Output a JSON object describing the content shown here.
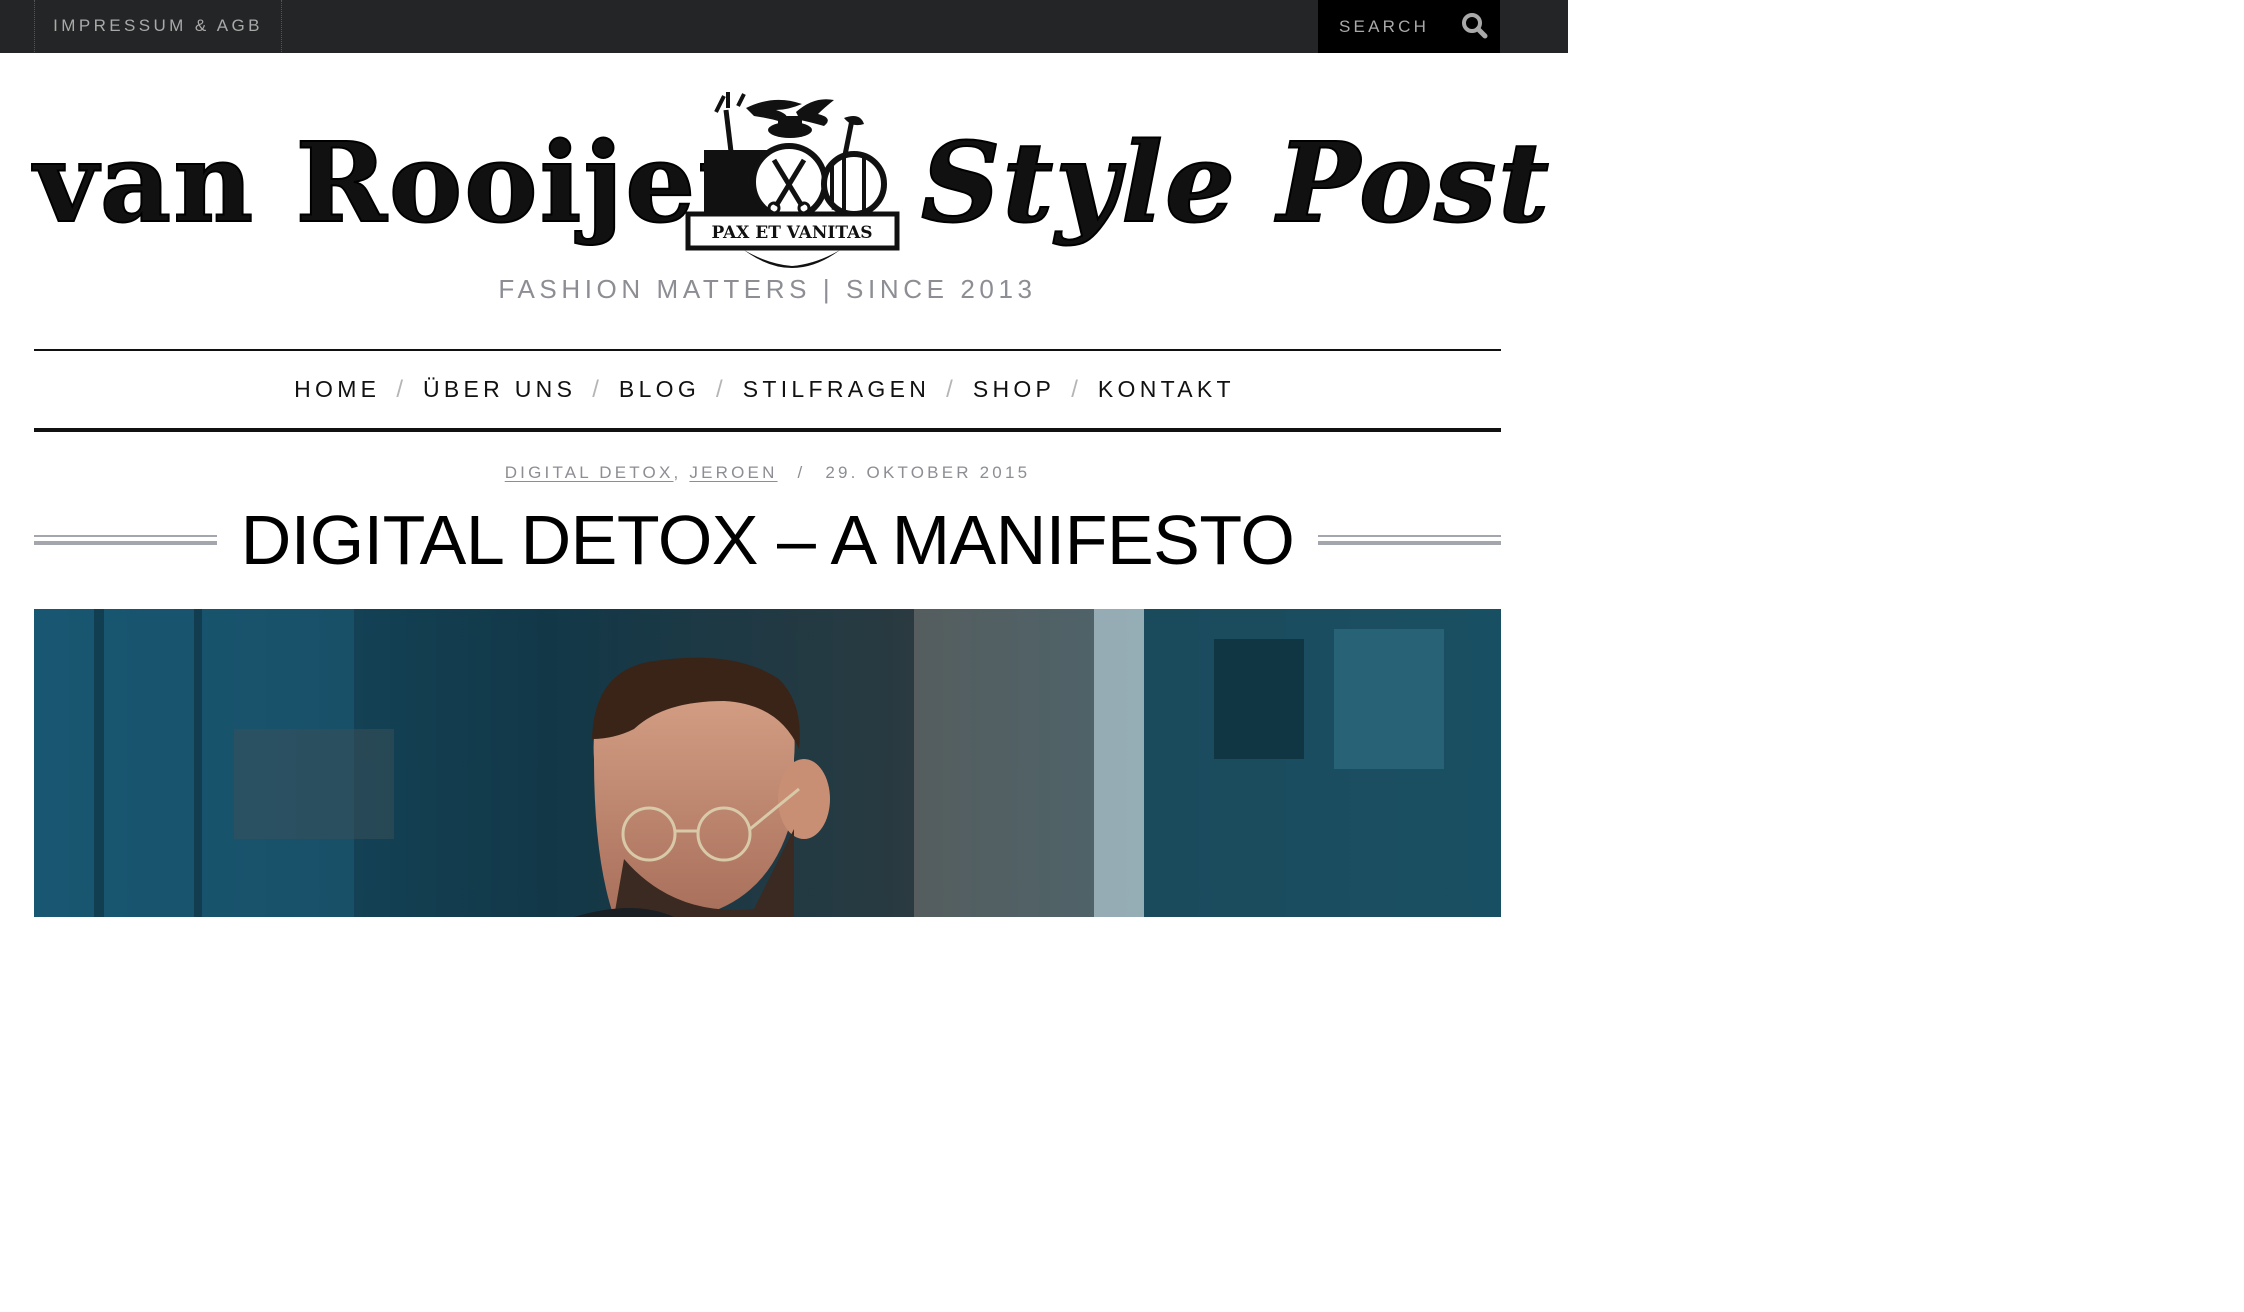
{
  "topbar": {
    "link_label": "IMPRESSUM & AGB",
    "search_placeholder": "SEARCH",
    "search_icon": "magnifier-icon"
  },
  "masthead": {
    "logo_left": "van Rooijen",
    "logo_right": "Style Post",
    "emblem_motto": "PAX ET VANITAS",
    "tagline": "FASHION MATTERS | SINCE 2013"
  },
  "nav": {
    "items": [
      {
        "label": "HOME"
      },
      {
        "label": "ÜBER UNS"
      },
      {
        "label": "BLOG"
      },
      {
        "label": "STILFRAGEN"
      },
      {
        "label": "SHOP"
      },
      {
        "label": "KONTAKT"
      }
    ],
    "separator": "/"
  },
  "post": {
    "categories": [
      "DIGITAL DETOX",
      "JEROEN"
    ],
    "category_separator": ",",
    "meta_separator": "/",
    "date": "29. OKTOBER 2015",
    "title": "DIGITAL DETOX – A MANIFESTO"
  },
  "colors": {
    "topbar_bg": "#242526",
    "search_bg": "#000000",
    "muted_text": "#8c8e94",
    "rule": "#a3a6ad",
    "hero_tone": "#15394a"
  }
}
